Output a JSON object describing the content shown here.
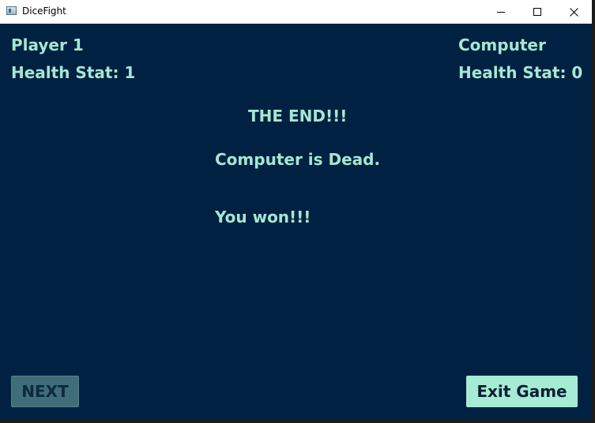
{
  "window": {
    "title": "DiceFight",
    "icon": "app-window-icon"
  },
  "player": {
    "name": "Player 1",
    "health_label": "Health Stat: 1"
  },
  "computer": {
    "name": "Computer",
    "health_label": "Health Stat: 0"
  },
  "result": {
    "title": "THE END!!!",
    "message": "Computer is Dead.",
    "outcome": "You won!!!"
  },
  "buttons": {
    "next_label": "NEXT",
    "exit_label": "Exit Game"
  },
  "colors": {
    "background": "#002142",
    "text": "#a6e6d2",
    "exit_button": "#a6ecd4",
    "next_button_disabled": "#3f6d79"
  }
}
